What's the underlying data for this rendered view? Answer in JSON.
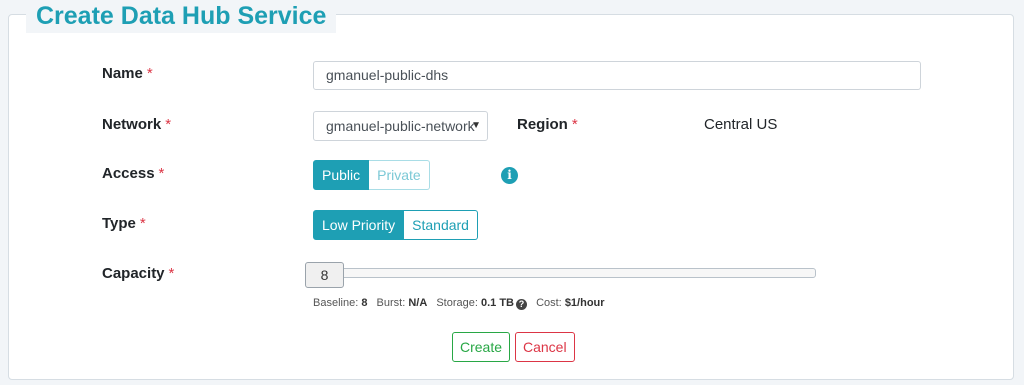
{
  "form": {
    "title": "Create Data Hub Service",
    "required_marker": "*",
    "name": {
      "label": "Name",
      "value": "gmanuel-public-dhs"
    },
    "network": {
      "label": "Network",
      "selected": "gmanuel-public-network"
    },
    "region": {
      "label": "Region",
      "value": "Central US"
    },
    "access": {
      "label": "Access",
      "options": [
        "Public",
        "Private"
      ],
      "selected": "Public"
    },
    "type": {
      "label": "Type",
      "options": [
        "Low Priority",
        "Standard"
      ],
      "selected": "Low Priority"
    },
    "capacity": {
      "label": "Capacity",
      "value": "8",
      "level_fraction": 0.0,
      "stats": {
        "baseline_label": "Baseline:",
        "baseline_value": "8",
        "burst_label": "Burst:",
        "burst_value": "N/A",
        "storage_label": "Storage:",
        "storage_value": "0.1 TB",
        "cost_label": "Cost:",
        "cost_value": "$1/hour"
      }
    },
    "buttons": {
      "create": "Create",
      "cancel": "Cancel"
    }
  },
  "icons": {
    "info": "info-icon",
    "help": "help-icon",
    "dropdown": "chevron-down-icon"
  },
  "colors": {
    "accent": "#1e9fb4",
    "required": "#dc3545",
    "create": "#28a745",
    "cancel": "#dc3545"
  }
}
